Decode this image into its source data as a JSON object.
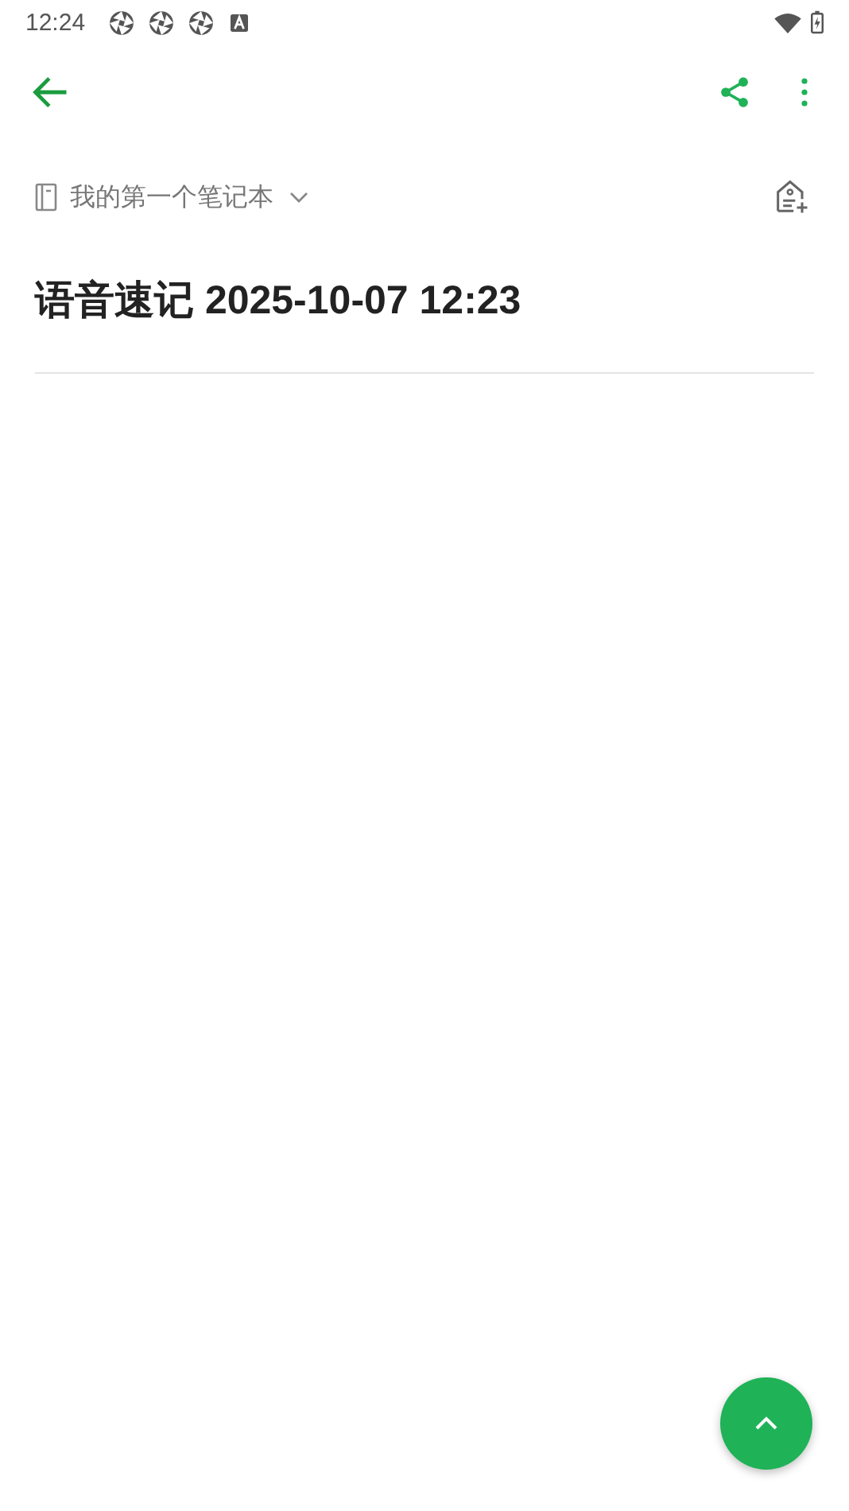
{
  "status_bar": {
    "time": "12:24"
  },
  "notebook": {
    "name": "我的第一个笔记本"
  },
  "note": {
    "title": "语音速记 2025-10-07 12:23"
  }
}
